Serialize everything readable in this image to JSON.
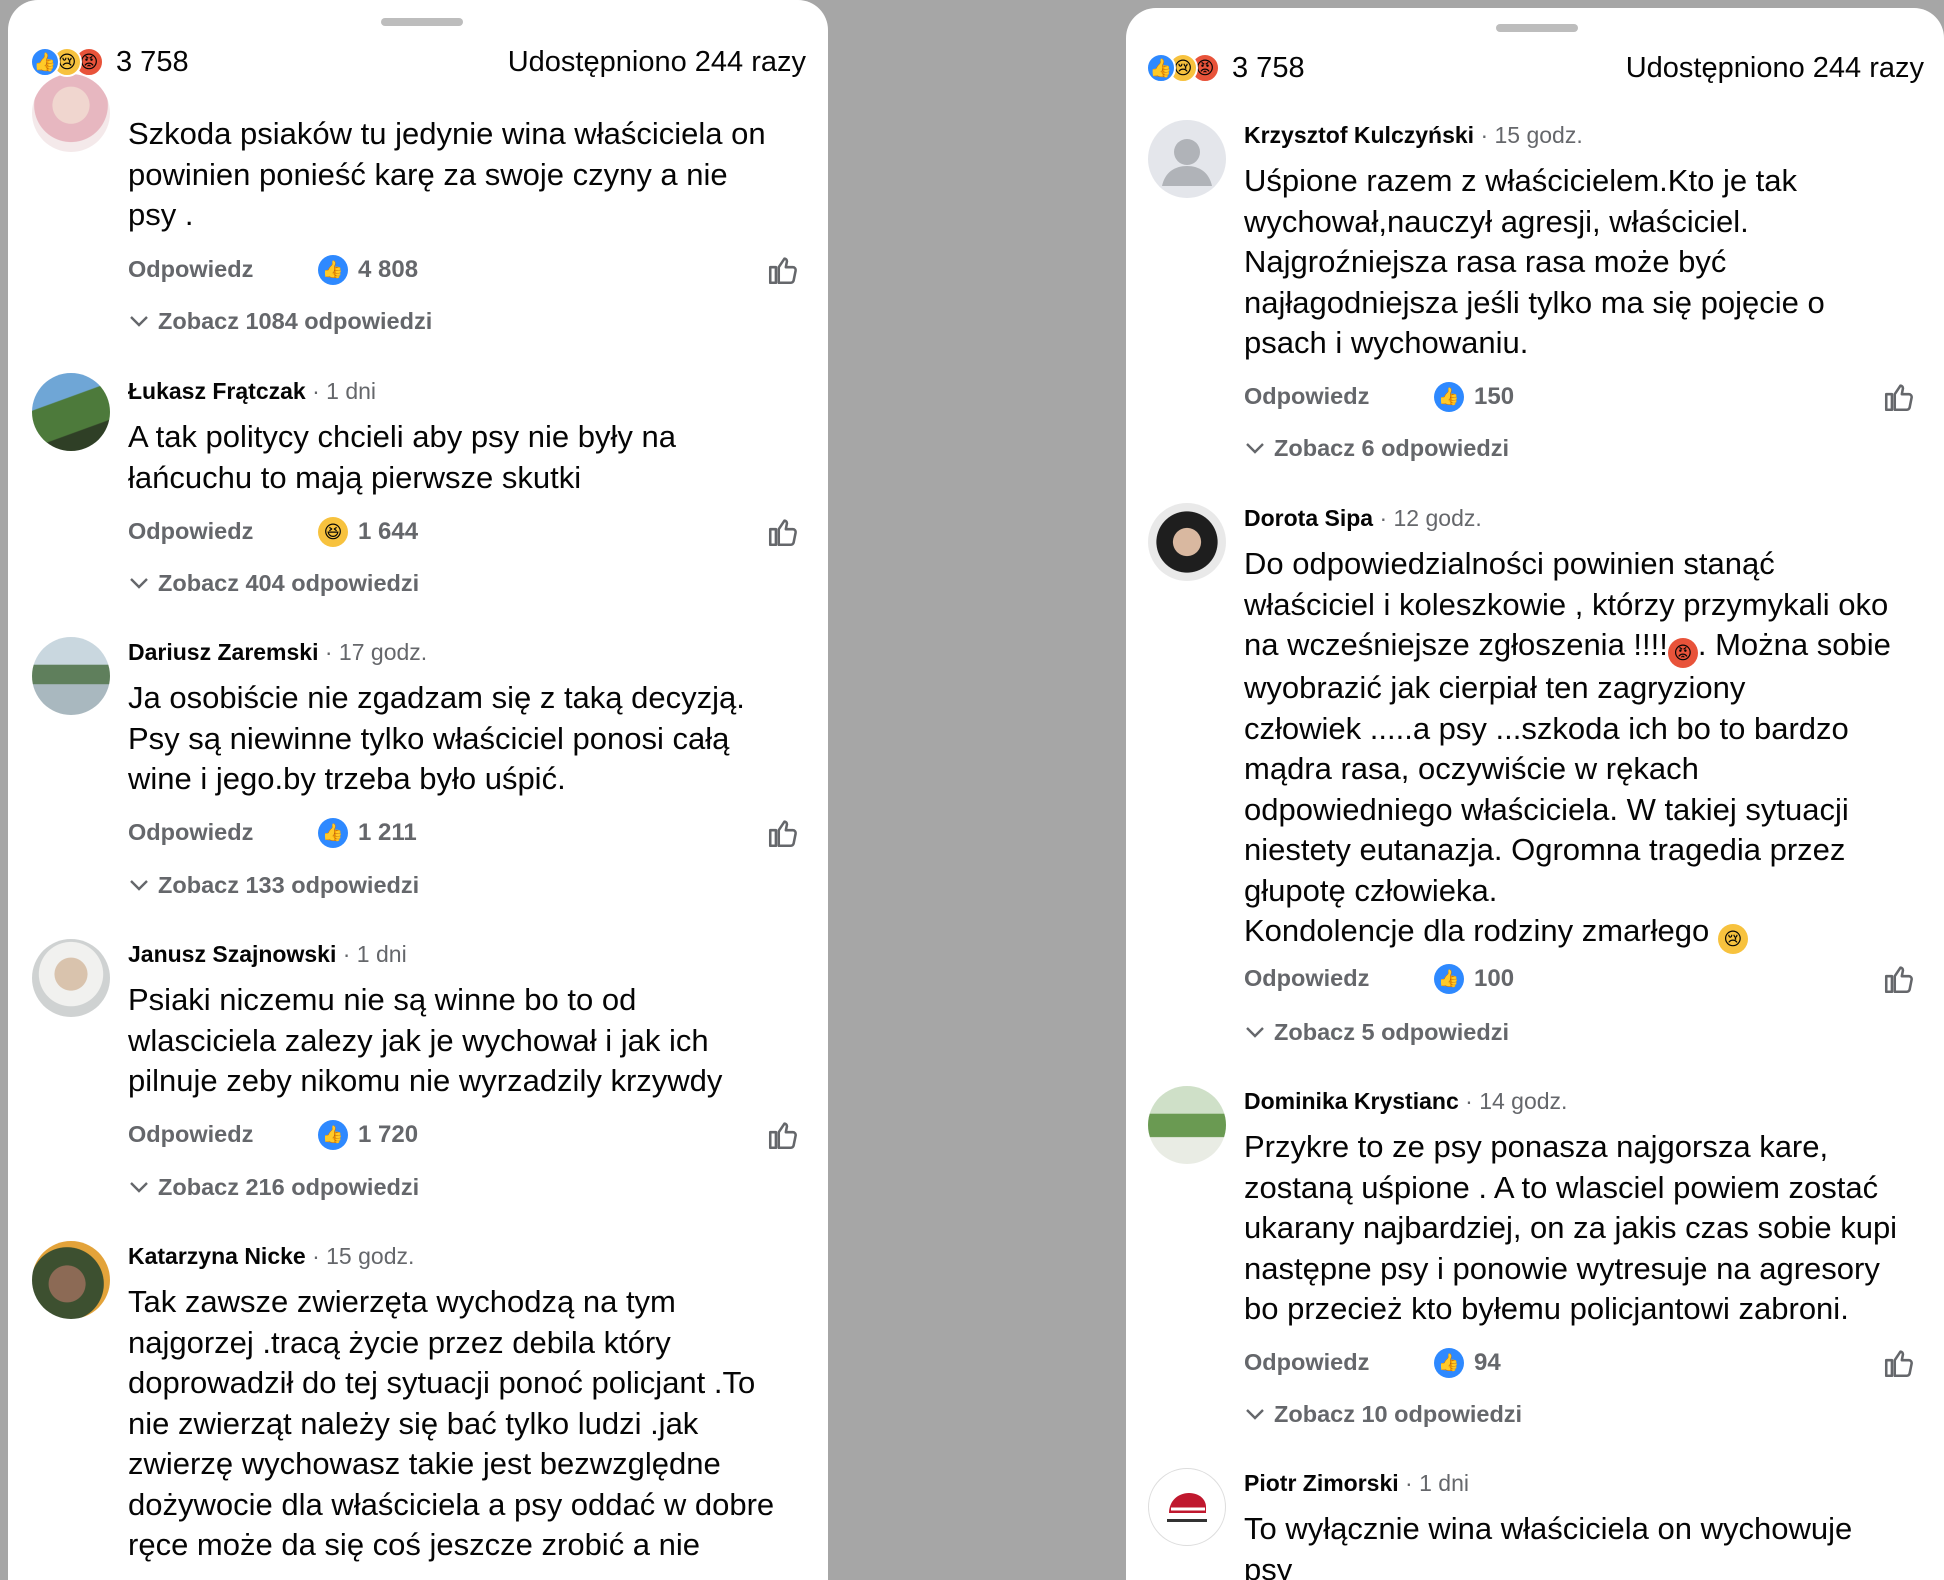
{
  "left": {
    "header": {
      "reaction_count": "3 758",
      "shares": "Udostępniono 244 razy",
      "reaction_icons": [
        "like-icon",
        "sad-icon",
        "angry-icon"
      ]
    },
    "comments": [
      {
        "author": "",
        "time": "",
        "text": "Szkoda psiaków tu jedynie wina właściciela on\npowinien ponieść karę za swoje czyny a nie\npsy .",
        "reply": "Odpowiedz",
        "reaction": "like",
        "likes": "4 808",
        "more": "Zobacz 1084 odpowiedzi"
      },
      {
        "author": "Łukasz Frątczak",
        "time": "· 1 dni",
        "text": "A tak politycy chcieli aby psy nie były na\nłańcuchu to mają pierwsze skutki",
        "reply": "Odpowiedz",
        "reaction": "haha",
        "likes": "1 644",
        "more": "Zobacz 404 odpowiedzi"
      },
      {
        "author": "Dariusz Zaremski",
        "time": "· 17 godz.",
        "text": "Ja osobiście nie zgadzam się  z taką decyzją.\nPsy są niewinne tylko właściciel ponosi całą\nwine  i jego.by trzeba było uśpić.",
        "reply": "Odpowiedz",
        "reaction": "like",
        "likes": "1 211",
        "more": "Zobacz 133 odpowiedzi"
      },
      {
        "author": "Janusz Szajnowski",
        "time": "· 1 dni",
        "text": "Psiaki niczemu nie są winne bo to od\nwlasciciela zalezy jak je wychował i jak ich\npilnuje zeby nikomu nie wyrzadzily krzywdy",
        "reply": "Odpowiedz",
        "reaction": "like",
        "likes": "1 720",
        "more": "Zobacz 216 odpowiedzi"
      },
      {
        "author": "Katarzyna Nicke",
        "time": "· 15 godz.",
        "text": "Tak zawsze zwierzęta wychodzą na tym\nnajgorzej .tracą życie przez debila który\ndoprowadził do tej sytuacji ponoć policjant .To\nnie zwierząt należy się bać tylko ludzi .jak\nzwierzę wychowasz takie jest bezwzględne\ndożywocie dla właściciela a psy oddać w dobre\nręce może da się coś jeszcze zrobić a nie"
      }
    ]
  },
  "right": {
    "header": {
      "reaction_count": "3 758",
      "shares": "Udostępniono 244 razy",
      "reaction_icons": [
        "like-icon",
        "sad-icon",
        "angry-icon"
      ]
    },
    "comments": [
      {
        "author": "Krzysztof Kulczyński",
        "time": "· 15 godz.",
        "text": "Uśpione razem z właścicielem.Kto je tak\nwychował,nauczył agresji, właściciel.\nNajgroźniejsza rasa rasa może być\nnajłagodniejsza jeśli tylko ma się pojęcie o\npsach i wychowaniu.",
        "reply": "Odpowiedz",
        "reaction": "like",
        "likes": "150",
        "more": "Zobacz 6 odpowiedzi"
      },
      {
        "author": "Dorota Sipa",
        "time": "· 12 godz.",
        "text_before_emoji": "Do odpowiedzialności powinien stanąć\nwłaściciel i koleszkowie , którzy przymykali oko\nna wcześniejsze zgłoszenia !!!!",
        "text_after_emoji": ". Można sobie\nwyobrazić jak cierpiał ten zagryziony\nczłowiek .....a psy ...szkoda  ich bo to bardzo\nmądra rasa, oczywiście w rękach\nodpowiedniego właściciela. W takiej sytuacji\nniestety eutanazja. Ogromna tragedia przez\ngłupotę człowieka.\nKondolencje dla rodziny zmarłego ",
        "reply": "Odpowiedz",
        "reaction": "like",
        "likes": "100",
        "more": "Zobacz 5 odpowiedzi"
      },
      {
        "author": "Dominika Krystianc",
        "time": "· 14 godz.",
        "text": "Przykre to ze psy ponasza najgorsza kare,\nzostaną uśpione . A to wlasciel powiem zostać\nukarany najbardziej, on za jakis czas sobie kupi\nnastępne psy i ponowie wytresuje na agresory\nbo przecież kto byłemu policjantowi zabroni.",
        "reply": "Odpowiedz",
        "reaction": "like",
        "likes": "94",
        "more": "Zobacz 10 odpowiedzi"
      },
      {
        "author": "Piotr Zimorski",
        "time": "· 1 dni",
        "text": "To wyłącznie wina właściciela on wychowuje\npsy"
      }
    ]
  },
  "colors": {
    "like_blue": "#2e89ff",
    "secondary_text": "#65676b",
    "divider_bg": "#a6a6a6"
  }
}
